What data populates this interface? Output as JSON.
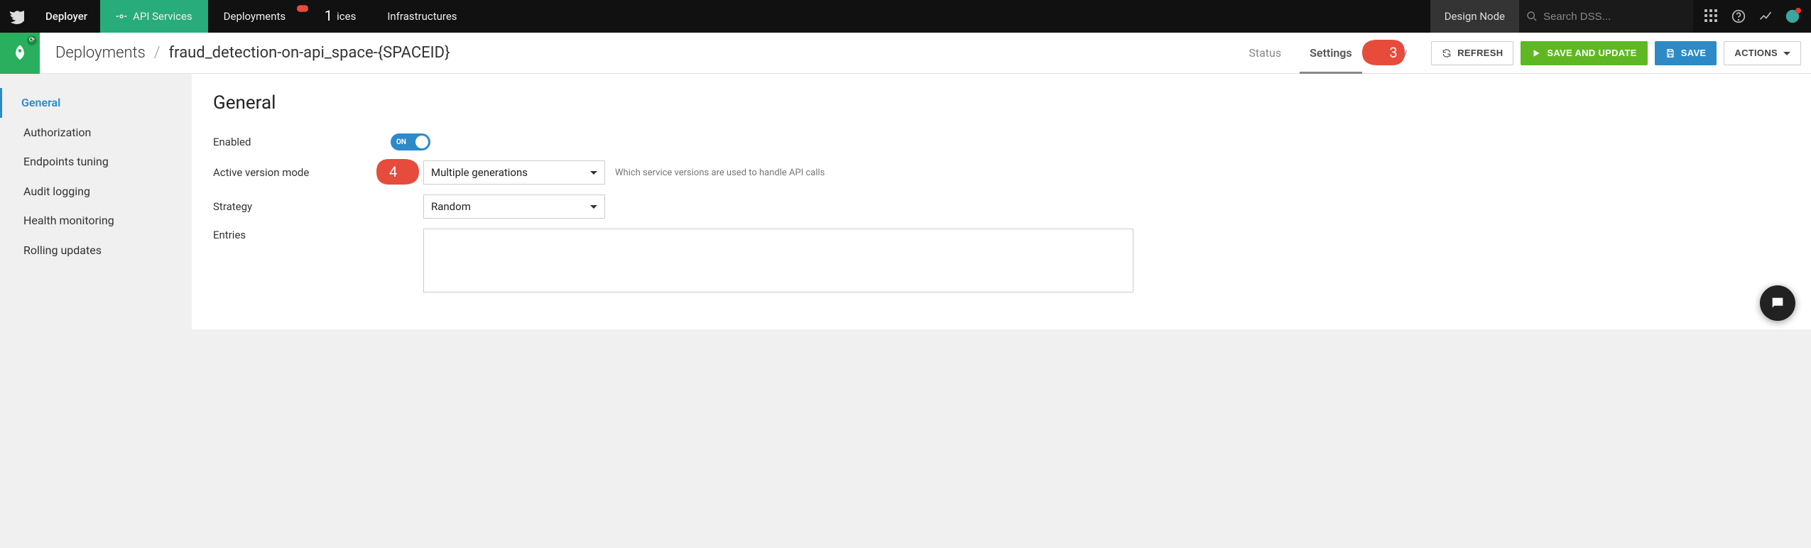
{
  "app": {
    "name": "Deployer"
  },
  "topnav": {
    "tabs": [
      {
        "label": "API Services",
        "active": true
      },
      {
        "label": "Deployments",
        "active": false
      },
      {
        "label": "Services",
        "active": false,
        "obscured": true,
        "visible_suffix": "ices"
      },
      {
        "label": "Infrastructures",
        "active": false
      }
    ],
    "node_label": "Design Node",
    "search_placeholder": "Search DSS..."
  },
  "breadcrumb": {
    "root": "Deployments",
    "name": "fraud_detection-on-api_space-{SPACEID}"
  },
  "pagetabs": [
    {
      "label": "Status",
      "active": false
    },
    {
      "label": "Settings",
      "active": true
    },
    {
      "label": "History",
      "active": false,
      "obscured": true,
      "visible_suffix": "y"
    }
  ],
  "buttons": {
    "refresh": "REFRESH",
    "save_update": "SAVE AND UPDATE",
    "save": "SAVE",
    "actions": "ACTIONS"
  },
  "sidenav": [
    "General",
    "Authorization",
    "Endpoints tuning",
    "Audit logging",
    "Health monitoring",
    "Rolling updates"
  ],
  "sidenav_active_index": 0,
  "panel": {
    "title": "General",
    "fields": {
      "enabled_label": "Enabled",
      "enabled_value": "ON",
      "active_version_mode_label": "Active version mode",
      "active_version_mode_value": "Multiple generations",
      "active_version_mode_hint": "Which service versions are used to handle API calls",
      "strategy_label": "Strategy",
      "strategy_value": "Random",
      "entries_label": "Entries"
    }
  },
  "callouts": {
    "c1": "1",
    "c3": "3",
    "c4": "4"
  }
}
